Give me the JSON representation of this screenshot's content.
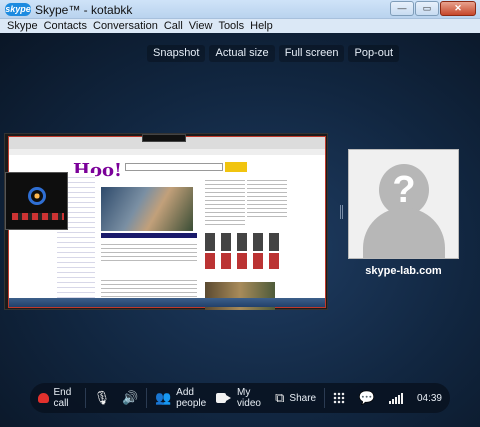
{
  "window": {
    "app_title": "Skype™ - kotabkk",
    "logo_text": "skype",
    "buttons": {
      "minimize": "—",
      "maximize": "▭",
      "close": "✕"
    }
  },
  "menu": [
    "Skype",
    "Contacts",
    "Conversation",
    "Call",
    "View",
    "Tools",
    "Help"
  ],
  "view_controls": [
    "Snapshot",
    "Actual size",
    "Full screen",
    "Pop-out"
  ],
  "shared_screen": {
    "browser_logo": "Hoo!"
  },
  "contact": {
    "display_name": "skype-lab.com",
    "avatar_icon": "question-mark-silhouette-icon",
    "avatar_glyph": "?"
  },
  "call_bar": {
    "end_call": "End call",
    "add_people": "Add people",
    "my_video": "My video",
    "share": "Share",
    "duration": "04:39",
    "icons": {
      "end_call": "phone-hangup-icon",
      "mute": "microphone-muted-icon",
      "volume": "speaker-icon",
      "add_people": "people-icon",
      "video": "video-camera-icon",
      "share": "screen-share-icon",
      "dialpad": "dialpad-icon",
      "im": "chat-bubble-icon",
      "signal": "signal-strength-icon"
    }
  },
  "colors": {
    "end_call_red": "#e2312d",
    "skype_blue": "#1d8be0",
    "stage_bg": "#112640"
  }
}
